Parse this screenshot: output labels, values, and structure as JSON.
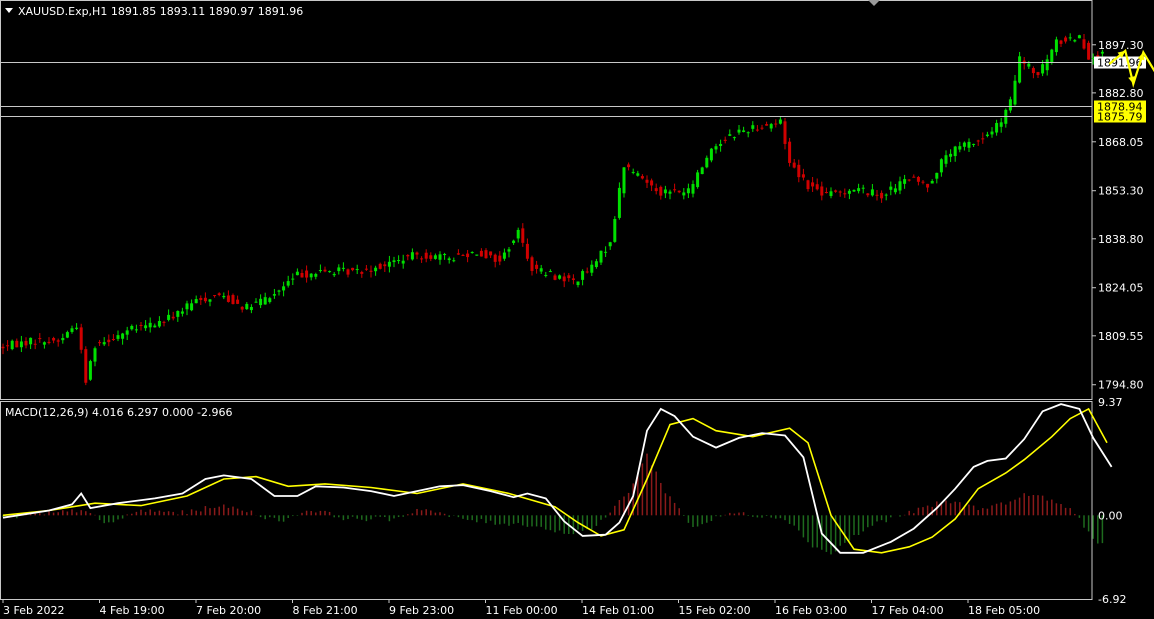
{
  "main_header": "XAUUSD.Exp,H1  1891.85 1893.11 1890.97 1891.96",
  "macd_header": "MACD(12,26,9) 4.016 6.297 0.000 -2.966",
  "colors": {
    "background": "#000000",
    "frame": "#c8c8c8",
    "bull": "#00e000",
    "bear": "#d00000",
    "macd_line": "#ffffff",
    "signal_line": "#ffff00",
    "hist_pos": "#8b1a1a",
    "hist_neg": "#1e6b1e",
    "annotation": "#ffff00",
    "hline": "#c8c8c8",
    "tag_bg": "#ffff00"
  },
  "chart_data": [
    {
      "type": "candlestick",
      "symbol": "XAUUSD.Exp",
      "timeframe": "H1",
      "ohlc_last": {
        "open": 1891.85,
        "high": 1893.11,
        "low": 1890.97,
        "close": 1891.96
      },
      "ylim": [
        1790.5,
        1910.5
      ],
      "y_ticks": [
        1897.3,
        1882.8,
        1868.05,
        1853.3,
        1838.8,
        1824.05,
        1809.55,
        1794.8
      ],
      "y_tick_labels": [
        "1897.30",
        "1882.80",
        "1868.05",
        "1853.30",
        "1838.80",
        "1824.05",
        "1809.55",
        "1794.80"
      ],
      "x_tick_labels": [
        "3 Feb 2022",
        "4 Feb 19:00",
        "7 Feb 20:00",
        "8 Feb 21:00",
        "9 Feb 23:00",
        "11 Feb 00:00",
        "14 Feb 01:00",
        "15 Feb 02:00",
        "16 Feb 03:00",
        "17 Feb 04:00",
        "18 Feb 05:00"
      ],
      "bar_count": 240,
      "path": [
        [
          0,
          1806
        ],
        [
          14,
          1808
        ],
        [
          26,
          1808
        ],
        [
          34,
          1813
        ],
        [
          38,
          1796
        ],
        [
          42,
          1807
        ],
        [
          56,
          1811
        ],
        [
          72,
          1814
        ],
        [
          86,
          1820
        ],
        [
          96,
          1822
        ],
        [
          108,
          1818
        ],
        [
          120,
          1822
        ],
        [
          130,
          1828
        ],
        [
          144,
          1829
        ],
        [
          156,
          1829
        ],
        [
          168,
          1831
        ],
        [
          182,
          1834
        ],
        [
          196,
          1833
        ],
        [
          208,
          1835
        ],
        [
          218,
          1832
        ],
        [
          226,
          1841
        ],
        [
          232,
          1830
        ],
        [
          240,
          1828
        ],
        [
          250,
          1826
        ],
        [
          258,
          1830
        ],
        [
          266,
          1838
        ],
        [
          272,
          1861
        ],
        [
          278,
          1858
        ],
        [
          288,
          1853
        ],
        [
          300,
          1853
        ],
        [
          310,
          1866
        ],
        [
          318,
          1870
        ],
        [
          326,
          1872
        ],
        [
          332,
          1873
        ],
        [
          340,
          1874
        ],
        [
          344,
          1862
        ],
        [
          352,
          1855
        ],
        [
          360,
          1852
        ],
        [
          372,
          1854
        ],
        [
          384,
          1852
        ],
        [
          396,
          1857
        ],
        [
          404,
          1855
        ],
        [
          412,
          1864
        ],
        [
          420,
          1867
        ],
        [
          428,
          1869
        ],
        [
          436,
          1874
        ],
        [
          440,
          1880
        ],
        [
          444,
          1893
        ],
        [
          452,
          1888
        ],
        [
          460,
          1898
        ],
        [
          470,
          1900
        ],
        [
          474,
          1894
        ],
        [
          480,
          1894
        ]
      ],
      "horizontal_lines": [
        {
          "value": 1891.96,
          "label": "1891.96",
          "tag": "current"
        },
        {
          "value": 1878.94,
          "label": "1878.94",
          "tag": "highlight"
        },
        {
          "value": 1875.79,
          "label": "1875.79",
          "tag": "highlight"
        }
      ],
      "annotation_path": [
        [
          1891.5,
          0
        ],
        [
          1895.5,
          16
        ],
        [
          1885.5,
          24
        ],
        [
          1895,
          34
        ],
        [
          1886,
          52
        ],
        [
          1913,
          76
        ]
      ]
    },
    {
      "type": "macd",
      "name": "MACD(12,26,9)",
      "values": {
        "macd": 4.016,
        "signal": 6.297,
        "level": 0.0,
        "histogram": -2.966
      },
      "ylim": [
        -6.92,
        9.37
      ],
      "y_ticks": [
        9.37,
        0.0,
        -6.92
      ],
      "y_tick_labels": [
        "9.37",
        "0.00",
        "-6.92"
      ],
      "macd_path": [
        [
          0,
          -0.2
        ],
        [
          20,
          0.4
        ],
        [
          30,
          0.9
        ],
        [
          34,
          1.8
        ],
        [
          38,
          0.6
        ],
        [
          50,
          1.0
        ],
        [
          66,
          1.4
        ],
        [
          78,
          1.8
        ],
        [
          88,
          3.0
        ],
        [
          96,
          3.3
        ],
        [
          108,
          3.0
        ],
        [
          118,
          1.6
        ],
        [
          128,
          1.6
        ],
        [
          136,
          2.4
        ],
        [
          148,
          2.3
        ],
        [
          160,
          2.0
        ],
        [
          170,
          1.6
        ],
        [
          180,
          2.0
        ],
        [
          190,
          2.4
        ],
        [
          200,
          2.5
        ],
        [
          212,
          2.0
        ],
        [
          222,
          1.5
        ],
        [
          228,
          1.8
        ],
        [
          236,
          1.4
        ],
        [
          244,
          -0.5
        ],
        [
          252,
          -1.7
        ],
        [
          262,
          -1.6
        ],
        [
          268,
          -0.6
        ],
        [
          274,
          1.6
        ],
        [
          280,
          7.0
        ],
        [
          286,
          8.8
        ],
        [
          292,
          8.2
        ],
        [
          300,
          6.5
        ],
        [
          310,
          5.6
        ],
        [
          320,
          6.4
        ],
        [
          330,
          6.8
        ],
        [
          340,
          6.6
        ],
        [
          348,
          4.8
        ],
        [
          356,
          -1.5
        ],
        [
          364,
          -3.1
        ],
        [
          374,
          -3.1
        ],
        [
          386,
          -2.2
        ],
        [
          396,
          -1.1
        ],
        [
          406,
          0.6
        ],
        [
          414,
          2.2
        ],
        [
          422,
          4.0
        ],
        [
          428,
          4.5
        ],
        [
          436,
          4.7
        ],
        [
          444,
          6.3
        ],
        [
          452,
          8.6
        ],
        [
          460,
          9.2
        ],
        [
          468,
          8.8
        ],
        [
          474,
          6.4
        ],
        [
          482,
          4.0
        ]
      ],
      "signal_path": [
        [
          0,
          0.0
        ],
        [
          20,
          0.4
        ],
        [
          40,
          1.0
        ],
        [
          60,
          0.8
        ],
        [
          80,
          1.6
        ],
        [
          96,
          3.0
        ],
        [
          110,
          3.2
        ],
        [
          124,
          2.4
        ],
        [
          140,
          2.6
        ],
        [
          160,
          2.3
        ],
        [
          180,
          1.8
        ],
        [
          200,
          2.6
        ],
        [
          220,
          1.8
        ],
        [
          240,
          0.7
        ],
        [
          250,
          -0.6
        ],
        [
          260,
          -1.7
        ],
        [
          270,
          -1.2
        ],
        [
          280,
          3.0
        ],
        [
          290,
          7.5
        ],
        [
          300,
          8.0
        ],
        [
          310,
          7.0
        ],
        [
          326,
          6.5
        ],
        [
          342,
          7.2
        ],
        [
          350,
          6.0
        ],
        [
          360,
          0.0
        ],
        [
          370,
          -2.8
        ],
        [
          382,
          -3.1
        ],
        [
          394,
          -2.6
        ],
        [
          404,
          -1.8
        ],
        [
          414,
          -0.3
        ],
        [
          424,
          2.2
        ],
        [
          436,
          3.5
        ],
        [
          444,
          4.6
        ],
        [
          456,
          6.5
        ],
        [
          464,
          8.0
        ],
        [
          472,
          8.8
        ],
        [
          480,
          6.0
        ]
      ],
      "histogram_path": [
        [
          0,
          -0.2
        ],
        [
          24,
          0.2
        ],
        [
          36,
          0.5
        ],
        [
          44,
          -0.8
        ],
        [
          60,
          0.4
        ],
        [
          80,
          0.2
        ],
        [
          92,
          0.8
        ],
        [
          104,
          0.5
        ],
        [
          120,
          -0.5
        ],
        [
          134,
          0.5
        ],
        [
          150,
          -0.3
        ],
        [
          170,
          -0.3
        ],
        [
          182,
          0.6
        ],
        [
          196,
          -0.2
        ],
        [
          212,
          -0.6
        ],
        [
          230,
          -0.8
        ],
        [
          244,
          -1.5
        ],
        [
          258,
          -1.0
        ],
        [
          272,
          2.0
        ],
        [
          280,
          5.0
        ],
        [
          288,
          2.0
        ],
        [
          300,
          -1.0
        ],
        [
          316,
          0.2
        ],
        [
          340,
          -0.2
        ],
        [
          352,
          -2.5
        ],
        [
          360,
          -3.2
        ],
        [
          368,
          -2.0
        ],
        [
          380,
          -0.6
        ],
        [
          394,
          0.2
        ],
        [
          410,
          1.2
        ],
        [
          424,
          0.6
        ],
        [
          436,
          1.0
        ],
        [
          446,
          1.8
        ],
        [
          456,
          1.2
        ],
        [
          466,
          0.3
        ],
        [
          474,
          -2.0
        ],
        [
          482,
          -2.9
        ]
      ]
    }
  ]
}
